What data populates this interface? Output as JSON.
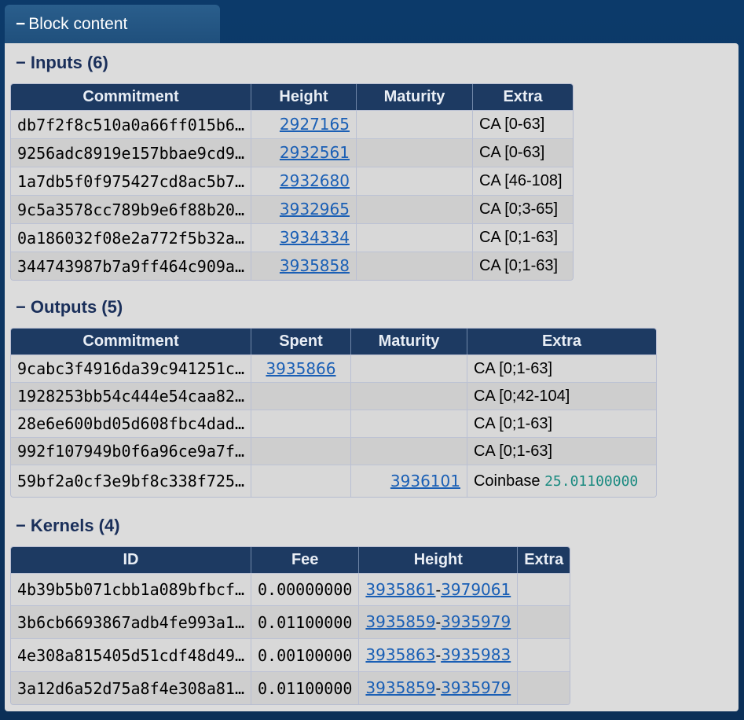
{
  "tab": {
    "dash": "−",
    "label": "Block content"
  },
  "inputs": {
    "dash": "−",
    "title": "Inputs (6)",
    "headers": [
      "Commitment",
      "Height",
      "Maturity",
      "Extra"
    ],
    "rows": [
      {
        "commitment": "db7f2f8c510a0a66ff015b6…",
        "height": "2927165",
        "maturity": "",
        "extra": "CA [0-63]"
      },
      {
        "commitment": "9256adc8919e157bbae9cd9…",
        "height": "2932561",
        "maturity": "",
        "extra": "CA [0-63]"
      },
      {
        "commitment": "1a7db5f0f975427cd8ac5b7…",
        "height": "2932680",
        "maturity": "",
        "extra": "CA [46-108]"
      },
      {
        "commitment": "9c5a3578cc789b9e6f88b20…",
        "height": "3932965",
        "maturity": "",
        "extra": "CA [0;3-65]"
      },
      {
        "commitment": "0a186032f08e2a772f5b32a…",
        "height": "3934334",
        "maturity": "",
        "extra": "CA [0;1-63]"
      },
      {
        "commitment": "344743987b7a9ff464c909a…",
        "height": "3935858",
        "maturity": "",
        "extra": "CA [0;1-63]"
      }
    ]
  },
  "outputs": {
    "dash": "−",
    "title": "Outputs (5)",
    "headers": [
      "Commitment",
      "Spent",
      "Maturity",
      "Extra"
    ],
    "rows": [
      {
        "commitment": "9cabc3f4916da39c941251c…",
        "spent": "3935866",
        "maturity": "",
        "extra": "CA [0;1-63]",
        "amount": ""
      },
      {
        "commitment": "1928253bb54c444e54caa82…",
        "spent": "",
        "maturity": "",
        "extra": "CA [0;42-104]",
        "amount": ""
      },
      {
        "commitment": "28e6e600bd05d608fbc4dad…",
        "spent": "",
        "maturity": "",
        "extra": "CA [0;1-63]",
        "amount": ""
      },
      {
        "commitment": "992f107949b0f6a96ce9a7f…",
        "spent": "",
        "maturity": "",
        "extra": "CA [0;1-63]",
        "amount": ""
      },
      {
        "commitment": "59bf2a0cf3e9bf8c338f725…",
        "spent": "",
        "maturity": "3936101",
        "extra": "Coinbase",
        "amount": "25.01100000"
      }
    ]
  },
  "kernels": {
    "dash": "−",
    "title": "Kernels (4)",
    "headers": [
      "ID",
      "Fee",
      "Height",
      "Extra"
    ],
    "rows": [
      {
        "id": "4b39b5b071cbb1a089bfbcf…",
        "fee": "0.00000000",
        "h_from": "3935861",
        "sep": "-",
        "h_to": "3979061",
        "extra": ""
      },
      {
        "id": "3b6cb6693867adb4fe993a1…",
        "fee": "0.01100000",
        "h_from": "3935859",
        "sep": "-",
        "h_to": "3935979",
        "extra": ""
      },
      {
        "id": "4e308a815405d51cdf48d49…",
        "fee": "0.00100000",
        "h_from": "3935863",
        "sep": "-",
        "h_to": "3935983",
        "extra": ""
      },
      {
        "id": "3a12d6a52d75a8f4e308a81…",
        "fee": "0.01100000",
        "h_from": "3935859",
        "sep": "-",
        "h_to": "3935979",
        "extra": ""
      }
    ]
  }
}
